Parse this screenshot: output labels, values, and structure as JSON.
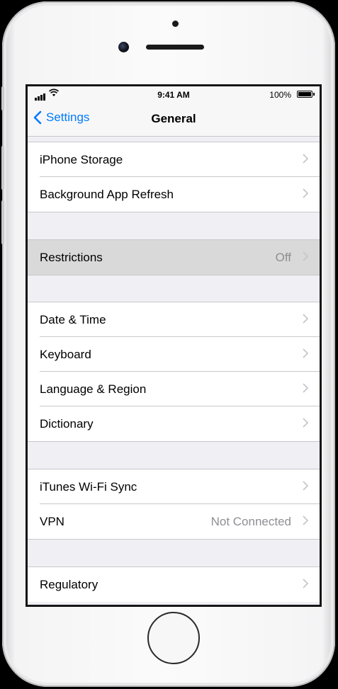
{
  "status": {
    "time": "9:41 AM",
    "battery": "100%"
  },
  "nav": {
    "back_label": "Settings",
    "title": "General"
  },
  "groups": [
    {
      "items": [
        {
          "label": "iPhone Storage",
          "value": ""
        },
        {
          "label": "Background App Refresh",
          "value": ""
        }
      ]
    },
    {
      "items": [
        {
          "label": "Restrictions",
          "value": "Off"
        }
      ]
    },
    {
      "items": [
        {
          "label": "Date & Time",
          "value": ""
        },
        {
          "label": "Keyboard",
          "value": ""
        },
        {
          "label": "Language & Region",
          "value": ""
        },
        {
          "label": "Dictionary",
          "value": ""
        }
      ]
    },
    {
      "items": [
        {
          "label": "iTunes Wi-Fi Sync",
          "value": ""
        },
        {
          "label": "VPN",
          "value": "Not Connected"
        }
      ]
    },
    {
      "items": [
        {
          "label": "Regulatory",
          "value": ""
        }
      ]
    }
  ],
  "colors": {
    "accent": "#007aff",
    "highlight": "#d9d9d9",
    "background": "#efeff4"
  }
}
